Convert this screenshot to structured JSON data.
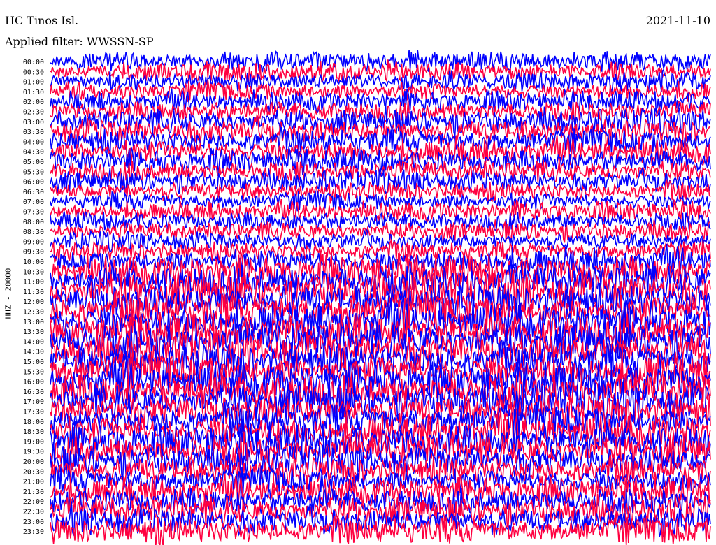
{
  "header": {
    "station": "HC Tinos Isl.",
    "date": "2021-11-10",
    "filter": "Applied filter: WWSSN-SP",
    "channel": "HHZ - 20000"
  },
  "chart_data": {
    "type": "line",
    "title": "",
    "y_ticks": [
      "00:00",
      "00:30",
      "01:00",
      "01:30",
      "02:00",
      "02:30",
      "03:00",
      "03:30",
      "04:00",
      "04:30",
      "05:00",
      "05:30",
      "06:00",
      "06:30",
      "07:00",
      "07:30",
      "08:00",
      "08:30",
      "09:00",
      "09:30",
      "10:00",
      "10:30",
      "11:00",
      "11:30",
      "12:00",
      "12:30",
      "13:00",
      "13:30",
      "14:00",
      "14:30",
      "15:00",
      "15:30",
      "16:00",
      "16:30",
      "17:00",
      "17:30",
      "18:00",
      "18:30",
      "19:00",
      "19:30",
      "20:00",
      "20:30",
      "21:00",
      "21:30",
      "22:00",
      "22:30",
      "23:00",
      "23:30"
    ],
    "series_colors": [
      "#0000ff",
      "#ff0040"
    ],
    "amplitude": [
      0.9,
      0.9,
      0.9,
      0.95,
      0.95,
      1.0,
      1.1,
      1.2,
      1.2,
      1.2,
      1.1,
      1.0,
      0.95,
      0.9,
      0.9,
      0.9,
      0.9,
      0.85,
      0.85,
      0.9,
      1.3,
      1.5,
      1.6,
      1.7,
      1.7,
      1.7,
      1.7,
      1.7,
      1.7,
      1.7,
      1.7,
      1.7,
      1.7,
      1.7,
      1.6,
      1.6,
      1.6,
      1.6,
      1.6,
      1.5,
      1.4,
      1.4,
      1.3,
      1.3,
      1.3,
      1.3,
      1.3,
      1.3
    ],
    "grid": false
  }
}
